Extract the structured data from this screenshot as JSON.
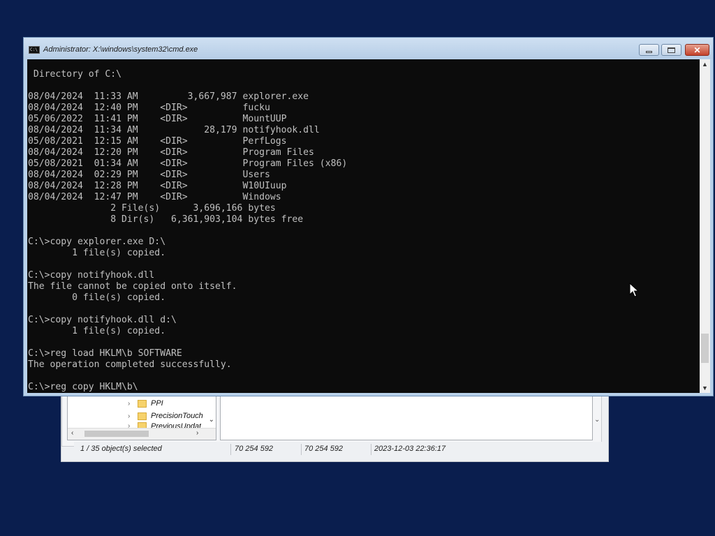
{
  "cmd": {
    "title": "Administrator: X:\\windows\\system32\\cmd.exe",
    "icon_text": "C:\\",
    "close_glyph": "✕",
    "lines": [
      " Directory of C:\\",
      "",
      "08/04/2024  11:33 AM         3,667,987 explorer.exe",
      "08/04/2024  12:40 PM    <DIR>          fucku",
      "05/06/2022  11:41 PM    <DIR>          MountUUP",
      "08/04/2024  11:34 AM            28,179 notifyhook.dll",
      "05/08/2021  12:15 AM    <DIR>          PerfLogs",
      "08/04/2024  12:20 PM    <DIR>          Program Files",
      "05/08/2021  01:34 AM    <DIR>          Program Files (x86)",
      "08/04/2024  02:29 PM    <DIR>          Users",
      "08/04/2024  12:28 PM    <DIR>          W10UIuup",
      "08/04/2024  12:47 PM    <DIR>          Windows",
      "               2 File(s)      3,696,166 bytes",
      "               8 Dir(s)   6,361,903,104 bytes free",
      "",
      "C:\\>copy explorer.exe D:\\",
      "        1 file(s) copied.",
      "",
      "C:\\>copy notifyhook.dll",
      "The file cannot be copied onto itself.",
      "        0 file(s) copied.",
      "",
      "C:\\>copy notifyhook.dll d:\\",
      "        1 file(s) copied.",
      "",
      "C:\\>reg load HKLM\\b SOFTWARE",
      "The operation completed successfully.",
      "",
      "C:\\>reg copy HKLM\\b\\"
    ]
  },
  "file_manager": {
    "tree_items": [
      "PPI",
      "PrecisionTouch",
      "PreviousUpdat"
    ],
    "status": {
      "selection": "1 / 35 object(s) selected",
      "size": "70 254 592",
      "packed_size": "70 254 592",
      "modified": "2023-12-03 22:36:17"
    }
  },
  "colors": {
    "desktop": "#0a1e4e",
    "console_bg": "#0c0c0c",
    "console_text": "#c0c0c0",
    "titlebar": "#b9d1ea",
    "close_button": "#c4432c"
  },
  "icons": [
    "cmd-app-icon",
    "minimize-icon",
    "maximize-icon",
    "close-icon",
    "folder-icon",
    "chevron-right-icon",
    "arrow-cursor-icon"
  ]
}
